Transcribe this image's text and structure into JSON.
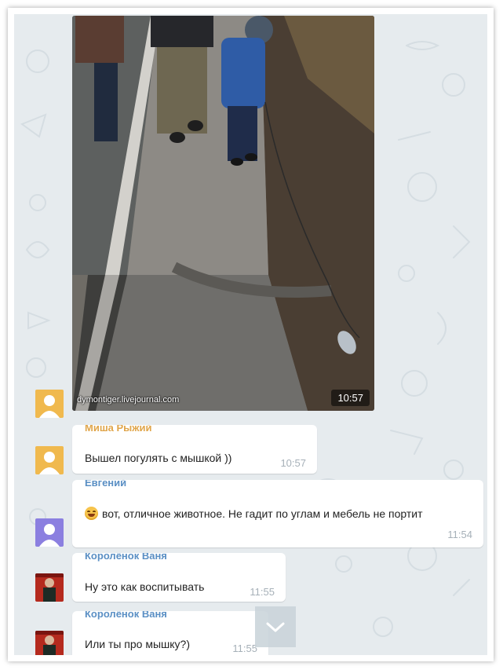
{
  "photo_message": {
    "watermark": "dymontiger.livejournal.com",
    "time": "10:57"
  },
  "messages": [
    {
      "sender": "Миша Рыжий",
      "sender_color": "#e0a54a",
      "text": "Вышел погулять с мышкой ))",
      "time": "10:57",
      "avatar": "yellow-user-avatar"
    },
    {
      "sender": "Евгений",
      "sender_color": "#5a8fc4",
      "emoji": "laughing-face-emoji",
      "text": "вот, отличное животное. Не гадит по углам и мебель не портит",
      "time": "11:54",
      "avatar": "purple-user-avatar"
    },
    {
      "sender": "Королёнок Ваня",
      "sender_color": "#5a8fc4",
      "text": "Ну это как воспитывать",
      "time": "11:55",
      "avatar": "photo-avatar"
    },
    {
      "sender": "Королёнок Ваня",
      "sender_color": "#5a8fc4",
      "text": "Или ты про мышку?)",
      "time": "11:55",
      "avatar": "photo-avatar"
    }
  ],
  "scroll_down_icon": "chevron-down-icon"
}
